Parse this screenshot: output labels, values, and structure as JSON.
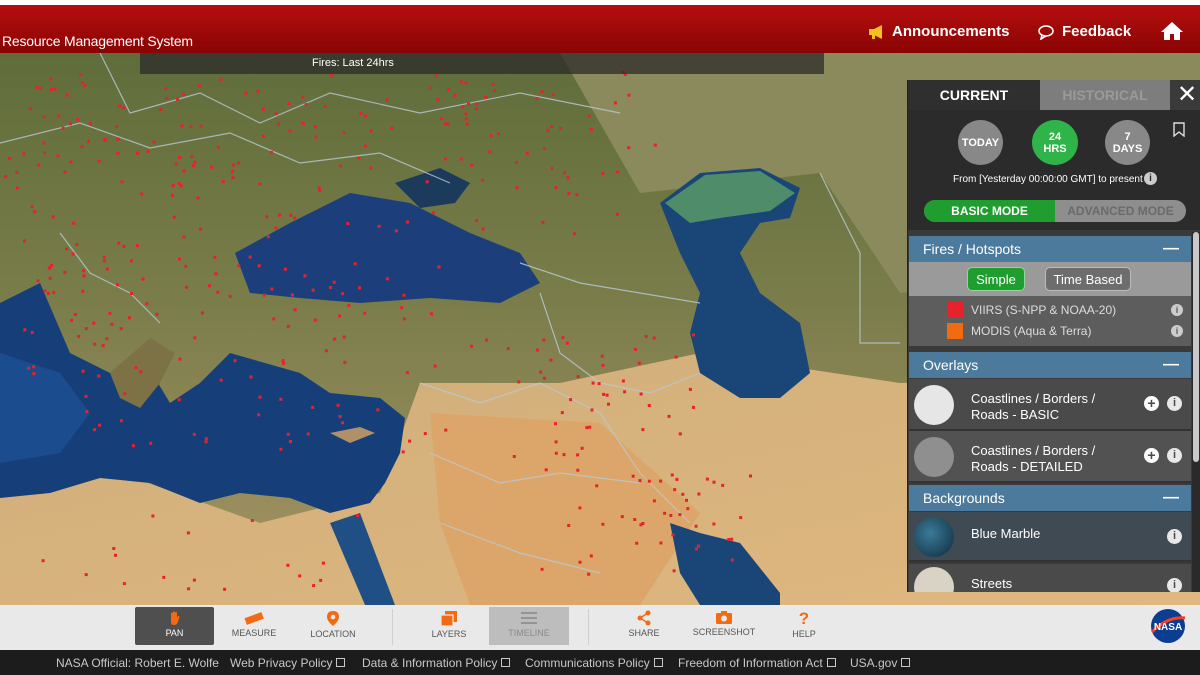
{
  "header": {
    "title": "Resource Management System",
    "announcements": "Announcements",
    "feedback": "Feedback"
  },
  "map": {
    "fires_label": "Fires: Last 24hrs"
  },
  "panel": {
    "tabs": [
      "CURRENT",
      "HISTORICAL"
    ],
    "time_buttons": [
      {
        "label": "TODAY",
        "active": false
      },
      {
        "label": "24 HRS",
        "active": true
      },
      {
        "label": "7 DAYS",
        "active": false
      }
    ],
    "time_range": "From [Yesterday 00:00:00 GMT] to present",
    "modes": [
      "BASIC MODE",
      "ADVANCED MODE"
    ],
    "sections": {
      "fires": {
        "title": "Fires / Hotspots",
        "subtabs": [
          "Simple",
          "Time Based"
        ],
        "legend": [
          {
            "label": "VIIRS (S-NPP & NOAA-20)",
            "color": "#e8222a"
          },
          {
            "label": "MODIS (Aqua & Terra)",
            "color": "#f26a12"
          }
        ]
      },
      "overlays": {
        "title": "Overlays",
        "items": [
          {
            "line1": "Coastlines / Borders /",
            "line2": "Roads - BASIC"
          },
          {
            "line1": "Coastlines / Borders /",
            "line2": "Roads - DETAILED"
          }
        ]
      },
      "backgrounds": {
        "title": "Backgrounds",
        "items": [
          "Blue Marble",
          "Streets"
        ]
      }
    }
  },
  "toolbar": {
    "tools": [
      "PAN",
      "MEASURE",
      "LOCATION",
      "LAYERS",
      "TIMELINE",
      "SHARE",
      "SCREENSHOT",
      "HELP"
    ],
    "logo": "NASA"
  },
  "footer": {
    "links": [
      "NASA Official: Robert E. Wolfe",
      "Web Privacy Policy",
      "Data & Information Policy",
      "Communications Policy",
      "Freedom of Information Act",
      "USA.gov"
    ]
  },
  "colors": {
    "header_red": "#a00808",
    "active_green": "#1f9d2f",
    "section_blue": "#4b7a9c",
    "fire_red": "#e8222a"
  }
}
